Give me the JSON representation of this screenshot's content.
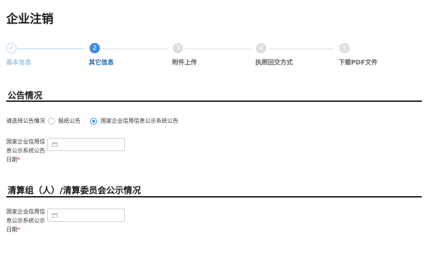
{
  "page_title": "企业注销",
  "steps": [
    {
      "number": "✓",
      "label": "基本信息",
      "state": "done"
    },
    {
      "number": "2",
      "label": "其它信息",
      "state": "active"
    },
    {
      "number": "3",
      "label": "附件上传",
      "state": "todo"
    },
    {
      "number": "4",
      "label": "执照回交方式",
      "state": "todo"
    },
    {
      "number": "5",
      "label": "下载PDF文件",
      "state": "todo"
    }
  ],
  "announcement": {
    "title": "公告情况",
    "select_label": "请选择公告情况",
    "options": [
      {
        "label": "报纸公告",
        "checked": false
      },
      {
        "label": "国家企业信用信息公示系统公告",
        "checked": true
      }
    ],
    "date_label_lines": [
      "国家企业信用信",
      "息公示系统公告",
      "日期"
    ],
    "required_mark": "*"
  },
  "liquidation": {
    "title": "清算组（人）/清算委员会公示情况",
    "date_label_lines": [
      "国家企业信用信",
      "息公示系统公示",
      "日期"
    ],
    "required_mark": "*"
  },
  "colors": {
    "accent": "#3d8ede",
    "required": "#e02020"
  },
  "icons": {
    "date": "calendar-icon"
  }
}
